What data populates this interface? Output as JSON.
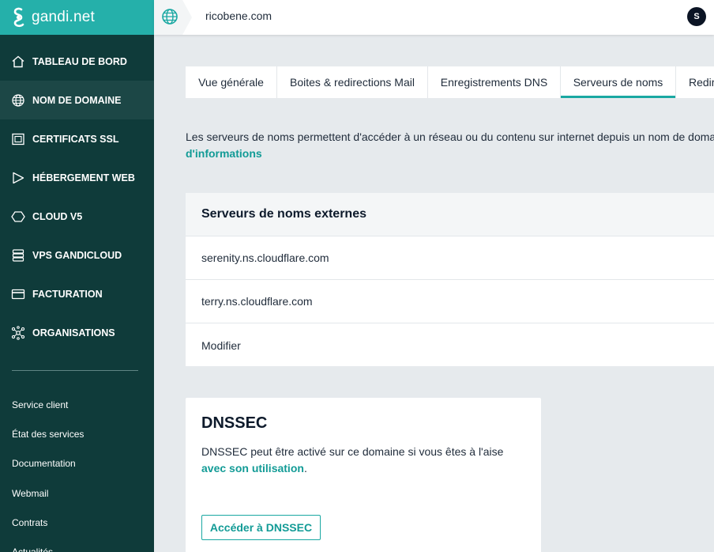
{
  "brand": {
    "name": "gandi.net",
    "logo_icon": "gandi-logo-icon"
  },
  "sidebar": {
    "items": [
      {
        "label": "TABLEAU DE BORD",
        "icon": "home-icon"
      },
      {
        "label": "NOM DE DOMAINE",
        "icon": "globe-icon",
        "active": true
      },
      {
        "label": "CERTIFICATS SSL",
        "icon": "certificate-icon"
      },
      {
        "label": "HÉBERGEMENT WEB",
        "icon": "play-icon"
      },
      {
        "label": "CLOUD V5",
        "icon": "hexagon-icon"
      },
      {
        "label": "VPS GANDICLOUD",
        "icon": "server-icon"
      },
      {
        "label": "FACTURATION",
        "icon": "credit-card-icon"
      },
      {
        "label": "ORGANISATIONS",
        "icon": "network-icon"
      }
    ],
    "links": [
      "Service client",
      "État des services",
      "Documentation",
      "Webmail",
      "Contrats",
      "Actualités"
    ]
  },
  "header": {
    "domain": "ricobene.com",
    "avatar_initial": "S"
  },
  "tabs": [
    "Vue générale",
    "Boites & redirections Mail",
    "Enregistrements DNS",
    "Serveurs de noms",
    "Redirections web"
  ],
  "active_tab": "Serveurs de noms",
  "intro": {
    "text": "Les serveurs de noms permettent d'accéder à un réseau ou du contenu sur internet depuis un nom de domaine.",
    "link": "d'informations"
  },
  "nameservers": {
    "title": "Serveurs de noms externes",
    "servers": [
      "serenity.ns.cloudflare.com",
      "terry.ns.cloudflare.com"
    ],
    "edit_label": "Modifier"
  },
  "dnssec": {
    "title": "DNSSEC",
    "text": "DNSSEC peut être activé sur ce domaine si vous êtes à l'aise",
    "link": "avec son utilisation",
    "suffix": ".",
    "button": "Accéder à DNSSEC"
  },
  "colors": {
    "sidebar": "#0f3b3a",
    "brand": "#25b0aa",
    "accent": "#1aa8a2",
    "link": "#129b96"
  }
}
